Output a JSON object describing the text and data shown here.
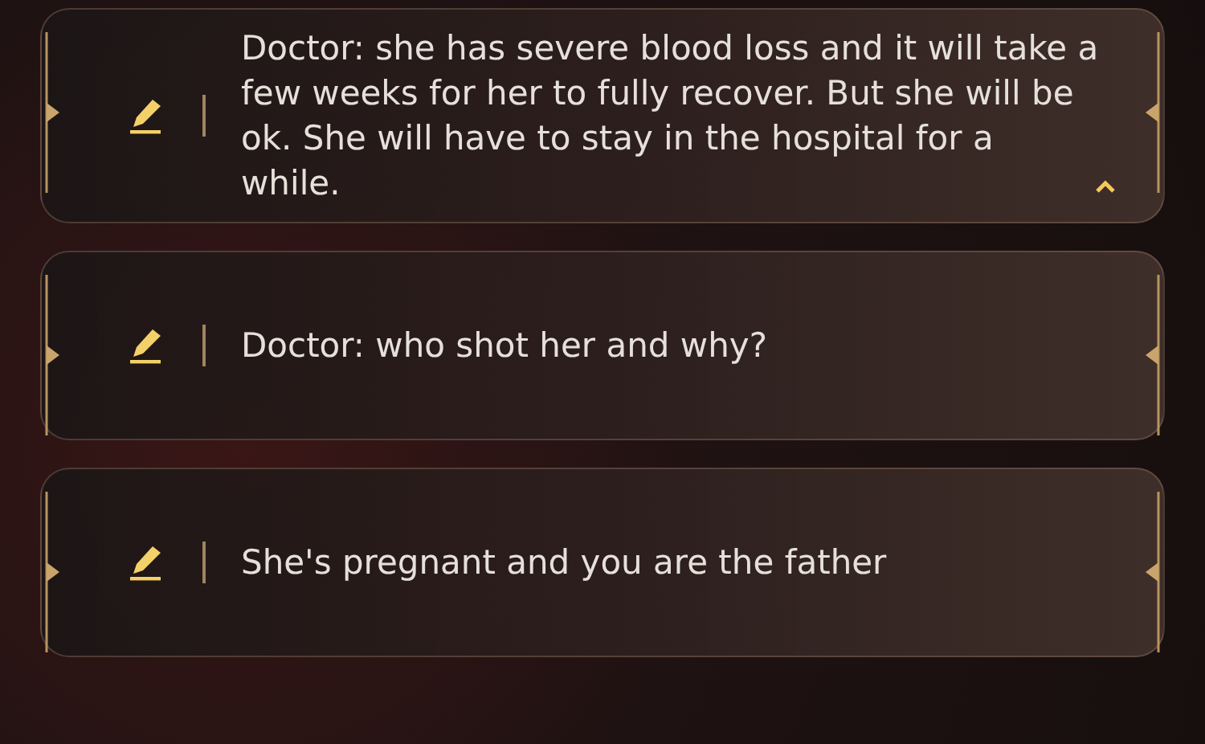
{
  "choices": [
    {
      "text": "Doctor: she has severe blood loss and it will take a few weeks for her to fully recover. But she will be ok. She will have to stay in the hospital for a while.",
      "expanded": true
    },
    {
      "text": "Doctor: who shot her and why?",
      "expanded": false
    },
    {
      "text": "She's pregnant and you are the father",
      "expanded": false
    }
  ]
}
